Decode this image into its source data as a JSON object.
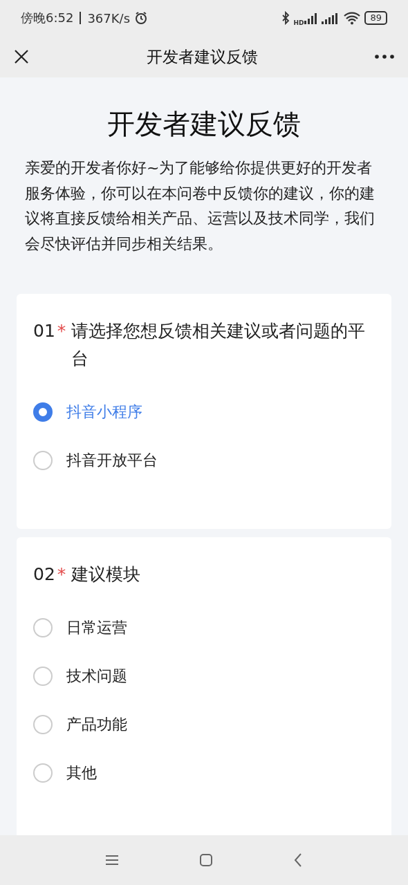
{
  "status_bar": {
    "time": "傍晚6:52",
    "speed": "367K/s",
    "network_label": "HD",
    "battery": "89"
  },
  "nav_bar": {
    "title": "开发者建议反馈"
  },
  "page": {
    "title": "开发者建议反馈",
    "intro": "亲爱的开发者你好~为了能够给你提供更好的开发者服务体验，你可以在本问卷中反馈你的建议，你的建议将直接反馈给相关产品、运营以及技术同学，我们会尽快评估并同步相关结果。"
  },
  "questions": [
    {
      "number": "01",
      "required_mark": "*",
      "text": "请选择您想反馈相关建议或者问题的平台",
      "options": [
        {
          "label": "抖音小程序",
          "selected": true
        },
        {
          "label": "抖音开放平台",
          "selected": false
        }
      ]
    },
    {
      "number": "02",
      "required_mark": "*",
      "text": "建议模块",
      "options": [
        {
          "label": "日常运营",
          "selected": false
        },
        {
          "label": "技术问题",
          "selected": false
        },
        {
          "label": "产品功能",
          "selected": false
        },
        {
          "label": "其他",
          "selected": false
        }
      ]
    }
  ]
}
